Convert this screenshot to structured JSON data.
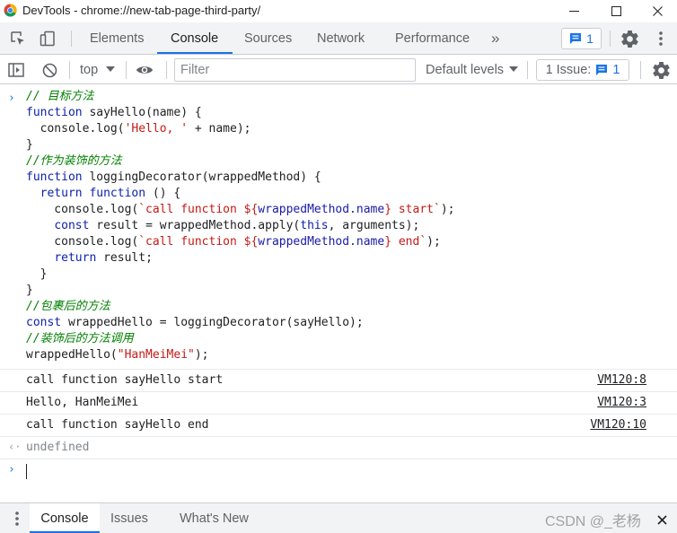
{
  "window": {
    "title": "DevTools - chrome://new-tab-page-third-party/"
  },
  "tabs": [
    {
      "label": "Elements"
    },
    {
      "label": "Console"
    },
    {
      "label": "Sources"
    },
    {
      "label": "Network"
    },
    {
      "label": "Performance"
    }
  ],
  "toolbar": {
    "more_tabs_label": "»",
    "messages_count": "1"
  },
  "console_toolbar": {
    "context": "top",
    "filter_placeholder": "Filter",
    "levels": "Default levels",
    "issues_label": "1 Issue:",
    "issues_count": "1"
  },
  "code_lines": [
    "// 目标方法",
    "function sayHello(name) {",
    "  console.log('Hello, ' + name);",
    "}",
    "//作为装饰的方法",
    "function loggingDecorator(wrappedMethod) {",
    "  return function () {",
    "    console.log(`call function ${wrappedMethod.name} start`);",
    "    const result = wrappedMethod.apply(this, arguments);",
    "    console.log(`call function ${wrappedMethod.name} end`);",
    "    return result;",
    "  }",
    "}",
    "//包裹后的方法",
    "const wrappedHello = loggingDecorator(sayHello);",
    "//装饰后的方法调用",
    "wrappedHello(\"HanMeiMei\");"
  ],
  "logs": [
    {
      "text": "call function sayHello start",
      "source": "VM120:8"
    },
    {
      "text": "Hello, HanMeiMei",
      "source": "VM120:3"
    },
    {
      "text": "call function sayHello end",
      "source": "VM120:10"
    }
  ],
  "result": "undefined",
  "drawer": {
    "tabs": [
      {
        "label": "Console"
      },
      {
        "label": "Issues"
      },
      {
        "label": "What's New"
      }
    ],
    "watermark": "CSDN @_老杨"
  },
  "colors": {
    "accent": "#1a73e8",
    "comment": "#008000",
    "keyword": "#0d22aa",
    "string": "#c41a16"
  }
}
